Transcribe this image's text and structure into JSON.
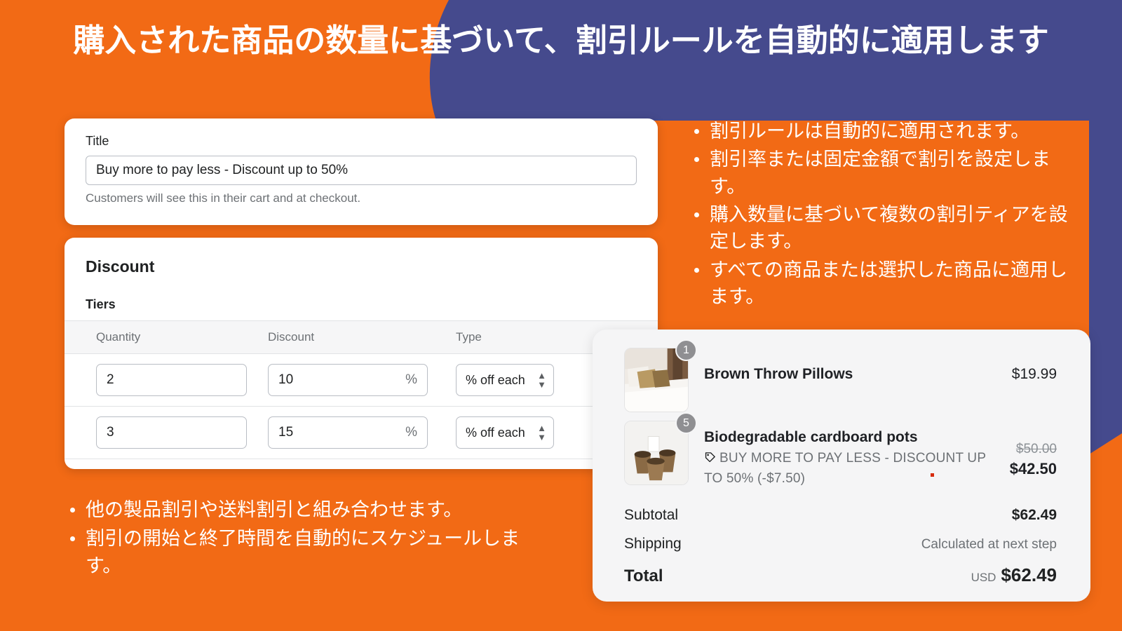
{
  "theme": {
    "orange": "#F26A15",
    "purple": "#454A8D",
    "white": "#FFFFFF",
    "cart_bg": "#F5F5F6",
    "badge_gray": "#8F8F92",
    "muted_text": "#6D7175",
    "strike_text": "#8C9196",
    "red_dot": "#D72C0D"
  },
  "headline": "購入された商品の数量に基づいて、割引ルールを自動的に適用します",
  "admin": {
    "title_card": {
      "label": "Title",
      "input_value": "Buy more to pay less - Discount up to 50%",
      "input_placeholder": "Title",
      "helper": "Customers will see this in their cart and at checkout."
    },
    "discount_card": {
      "heading": "Discount",
      "subheading": "Tiers",
      "columns": [
        "Quantity",
        "Discount",
        "Type"
      ],
      "rows": [
        {
          "quantity": "2",
          "discount": "10",
          "discount_suffix": "%",
          "type": "% off each"
        },
        {
          "quantity": "3",
          "discount": "15",
          "discount_suffix": "%",
          "type": "% off each"
        }
      ]
    }
  },
  "bullets_right": [
    "割引ルールは自動的に適用されます。",
    "割引率または固定金額で割引を設定します。",
    "購入数量に基づいて複数の割引ティアを設定します。",
    "すべての商品または選択した商品に適用します。"
  ],
  "bullets_bottom": [
    "他の製品割引や送料割引と組み合わせます。",
    "割引の開始と終了時間を自動的にスケジュールします。"
  ],
  "cart": {
    "items": [
      {
        "qty": "1",
        "name": "Brown Throw Pillows",
        "discount_text": "",
        "price": "$19.99",
        "price_strike": "",
        "thumb": "pillows-photo"
      },
      {
        "qty": "5",
        "name": "Biodegradable cardboard pots",
        "discount_text": "BUY MORE TO PAY LESS - DISCOUNT UP TO 50% (-$7.50)",
        "price": "$42.50",
        "price_strike": "$50.00",
        "thumb": "cardboard-pots-photo"
      }
    ],
    "totals": [
      {
        "label": "Subtotal",
        "value": "$62.49",
        "muted": false
      },
      {
        "label": "Shipping",
        "value": "Calculated at next step",
        "muted": true
      }
    ],
    "grand_total": {
      "label": "Total",
      "currency": "USD",
      "value": "$62.49"
    }
  },
  "icons": {
    "tag": "tag-icon",
    "select_caret": "chevron-updown-icon"
  }
}
